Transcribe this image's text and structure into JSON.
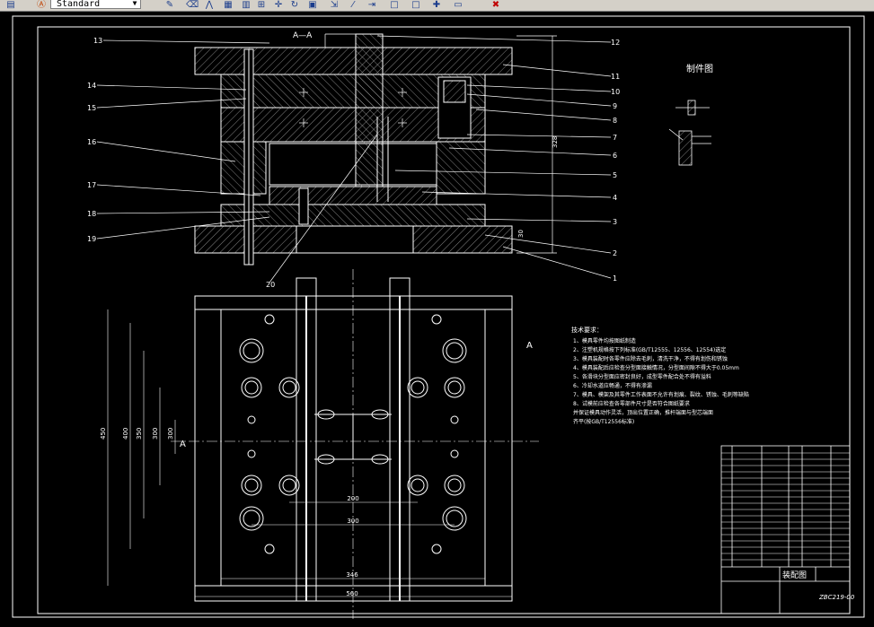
{
  "toolbar": {
    "text_style": "Standard",
    "icons": [
      "text-style-icon",
      "pencil-icon",
      "eraser-icon",
      "mirror-icon",
      "array-icon",
      "grid-icon",
      "move-icon",
      "rotate-icon",
      "scale-icon",
      "stretch-icon",
      "trim-icon",
      "extend-icon",
      "break-icon",
      "chamfer-icon",
      "fillet-icon",
      "explode-icon",
      "properties-icon"
    ]
  },
  "drawing": {
    "section_label": "A—A",
    "part_drawing_title": "制件图",
    "tech_title": "技术要求：",
    "tech_lines": [
      "1、模具零件均按图纸制造",
      "2、注塑机规格按下列标准(GB/T12555、12556、12554)选定",
      "3、模具装配时各零件应除去毛刺，清洗干净，不得有划伤和锈蚀",
      "4、模具装配后应检查分型面接触情况，分型面间隙不得大于0.05mm",
      "5、各滑块分型面应密封良好，成型零件配合处不得有溢料",
      "6、冷却水道应畅通，不得有渗漏",
      "7、模具、模架及其零件工作表面不允许有划痕、裂纹、锈蚀、毛刺等缺陷",
      "8、试模前应检查各零部件尺寸是否符合图纸要求",
      "   并保证模具动作灵活，顶出位置正确，推杆端面与型芯端面",
      "   齐平(按GB/T12556标准)"
    ],
    "title_block_name": "装配图",
    "drawing_no": "ZBC219-00",
    "company": "",
    "part_numbers": [
      "13",
      "14",
      "15",
      "16",
      "17",
      "18",
      "19",
      "20",
      "12",
      "11",
      "10",
      "9",
      "8",
      "7",
      "6",
      "5",
      "4",
      "3",
      "2",
      "1"
    ],
    "view_mark": "A",
    "dim_overall_width": "560",
    "dim_bottom": "346",
    "dim_mid": "300",
    "dim_inner": "200",
    "dim_height_left": "450",
    "dim_height_2": "400",
    "dim_height_3": "350",
    "dim_height_4": "300",
    "dim_height_total": "300",
    "dim_top_right": "328",
    "dim_plate": "30"
  }
}
